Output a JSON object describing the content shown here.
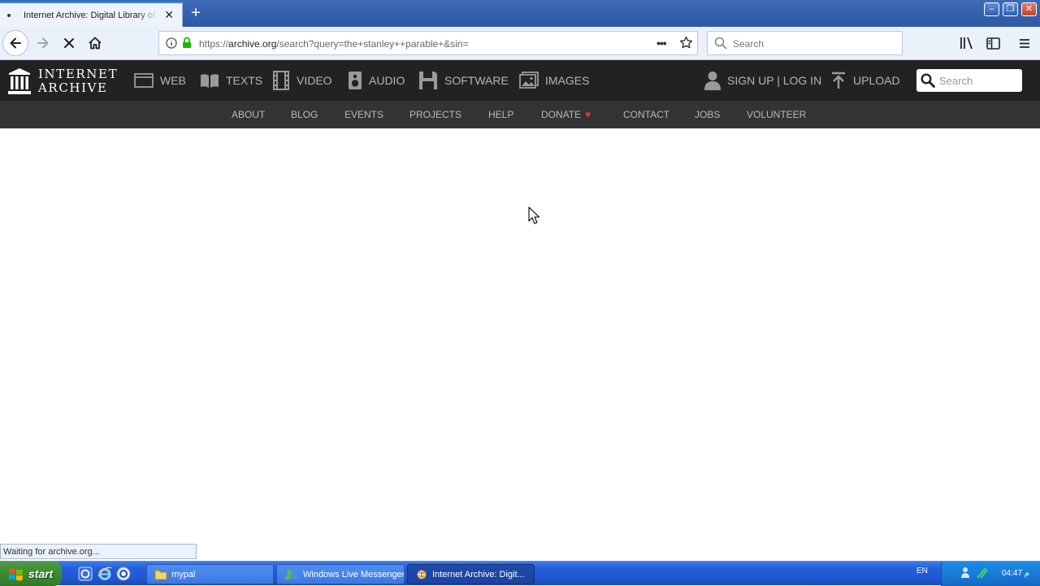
{
  "browser": {
    "tab": {
      "title": "Internet Archive: Digital Library of Free & Borrowable Books, Movies, Music & Wayback Machine"
    },
    "url": {
      "prefix": "https://",
      "domain": "archive.org",
      "path": "/search?query=the+stanley++parable+&sin="
    },
    "search": {
      "placeholder": "Search"
    },
    "status": "Waiting for archive.org..."
  },
  "archive": {
    "logo": {
      "line1": "INTERNET",
      "line2": "ARCHIVE"
    },
    "menu": {
      "web": "WEB",
      "texts": "TEXTS",
      "video": "VIDEO",
      "audio": "AUDIO",
      "software": "SOFTWARE",
      "images": "IMAGES"
    },
    "account": "SIGN UP | LOG IN",
    "upload": "UPLOAD",
    "search_placeholder": "Search",
    "subnav": {
      "about": "ABOUT",
      "blog": "BLOG",
      "events": "EVENTS",
      "projects": "PROJECTS",
      "help": "HELP",
      "donate": "DONATE",
      "contact": "CONTACT",
      "jobs": "JOBS",
      "volunteer": "VOLUNTEER"
    }
  },
  "taskbar": {
    "start": "start",
    "tasks": [
      "mypal",
      "Windows Live Messenger",
      "Internet Archive: Digit..."
    ],
    "language": "EN",
    "clock": "04:47 ‫م‬"
  },
  "icons": {
    "tab_close": "close-icon",
    "new_tab": "plus-icon",
    "back": "arrow-left-icon",
    "forward": "arrow-right-icon",
    "stop": "stop-icon",
    "home": "home-icon",
    "info": "info-icon",
    "lock": "lock-icon",
    "more": "ellipsis-icon",
    "bookmark": "star-icon",
    "library": "library-icon",
    "sidebar": "sidebar-icon",
    "menu": "hamburger-icon",
    "heart": "heart-icon"
  },
  "colors": {
    "archive_header": "#222222",
    "archive_subnav": "#333333",
    "donate_heart": "#e53935",
    "lock_green": "#12bc00",
    "taskbar_blue": "#245edb",
    "start_green": "#3c8e35"
  }
}
